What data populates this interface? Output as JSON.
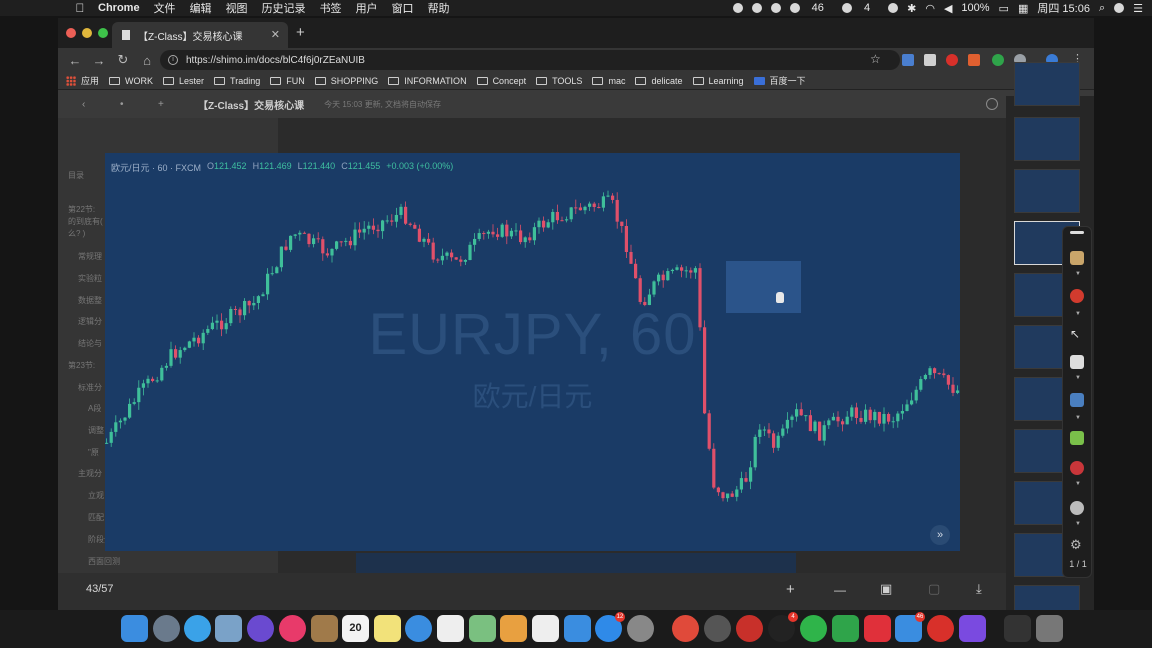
{
  "menubar": {
    "app": "Chrome",
    "items": [
      "文件",
      "编辑",
      "视图",
      "历史记录",
      "书签",
      "用户",
      "窗口",
      "帮助"
    ],
    "status": {
      "badge1": "46",
      "badge2": "4",
      "battery": "100%",
      "clock": "周四 15:06"
    }
  },
  "browser": {
    "tab_title": "【Z-Class】交易核心课",
    "url": "https://shimo.im/docs/blC4f6j0rZEaNUIB",
    "bookmarks": [
      "应用",
      "WORK",
      "Lester",
      "Trading",
      "FUN",
      "SHOPPING",
      "INFORMATION",
      "Concept",
      "TOOLS",
      "mac",
      "delicate",
      "Learning",
      "百度一下"
    ]
  },
  "doc": {
    "title": "【Z-Class】交易核心课",
    "status": "今天 15:03 更新, 文档将自动保存",
    "outline": [
      {
        "label": "目录"
      },
      {
        "label": "第22节:"
      },
      {
        "label": "的到底有("
      },
      {
        "label": "么? )"
      },
      {
        "label": "常规理"
      },
      {
        "label": "实验粒"
      },
      {
        "label": "数据整"
      },
      {
        "label": "逻辑分"
      },
      {
        "label": "结论与"
      },
      {
        "label": "第23节:"
      },
      {
        "label": "标准分"
      },
      {
        "label": "A段"
      },
      {
        "label": "调整"
      },
      {
        "label": "\"原"
      },
      {
        "label": "主观分"
      },
      {
        "label": "立观"
      },
      {
        "label": "匹配"
      },
      {
        "label": "阶段分层"
      },
      {
        "label": "西面回测"
      }
    ]
  },
  "viewer": {
    "page_indicator": "43/57",
    "plus": "+",
    "minus": "—"
  },
  "chart": {
    "pair": "欧元/日元 · 60 · FXCM",
    "open_label": "O",
    "open": "121.452",
    "high_label": "H",
    "high": "121.469",
    "low_label": "L",
    "low": "121.440",
    "close_label": "C",
    "close": "121.455",
    "change": "+0.003 (+0.00%)",
    "watermark_symbol": "EURJPY, 60",
    "watermark_name": "欧元/日元",
    "up_color": "#3fbf9a",
    "down_color": "#e0506a"
  },
  "annotation_toolbar": {
    "counter": "1 / 1"
  },
  "dock": {
    "date": "20",
    "badges": [
      "12",
      "4",
      "46"
    ]
  }
}
